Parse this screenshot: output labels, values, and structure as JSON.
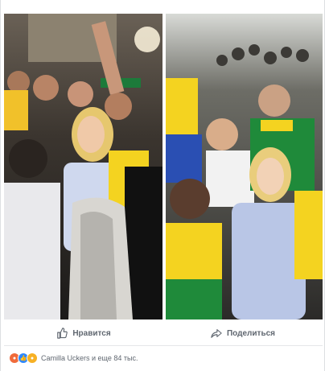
{
  "actions": {
    "like_label": "Нравится",
    "share_label": "Поделиться"
  },
  "reactions": {
    "icons": [
      "angry-react",
      "like-react",
      "sad-react"
    ],
    "summary": "Camilla Uckers и еще 84 тыс."
  },
  "colors": {
    "text_muted": "#606770",
    "like_blue": "#2d88ff",
    "brazil_yellow": "#f4d320",
    "brazil_green": "#1f8a3a"
  }
}
